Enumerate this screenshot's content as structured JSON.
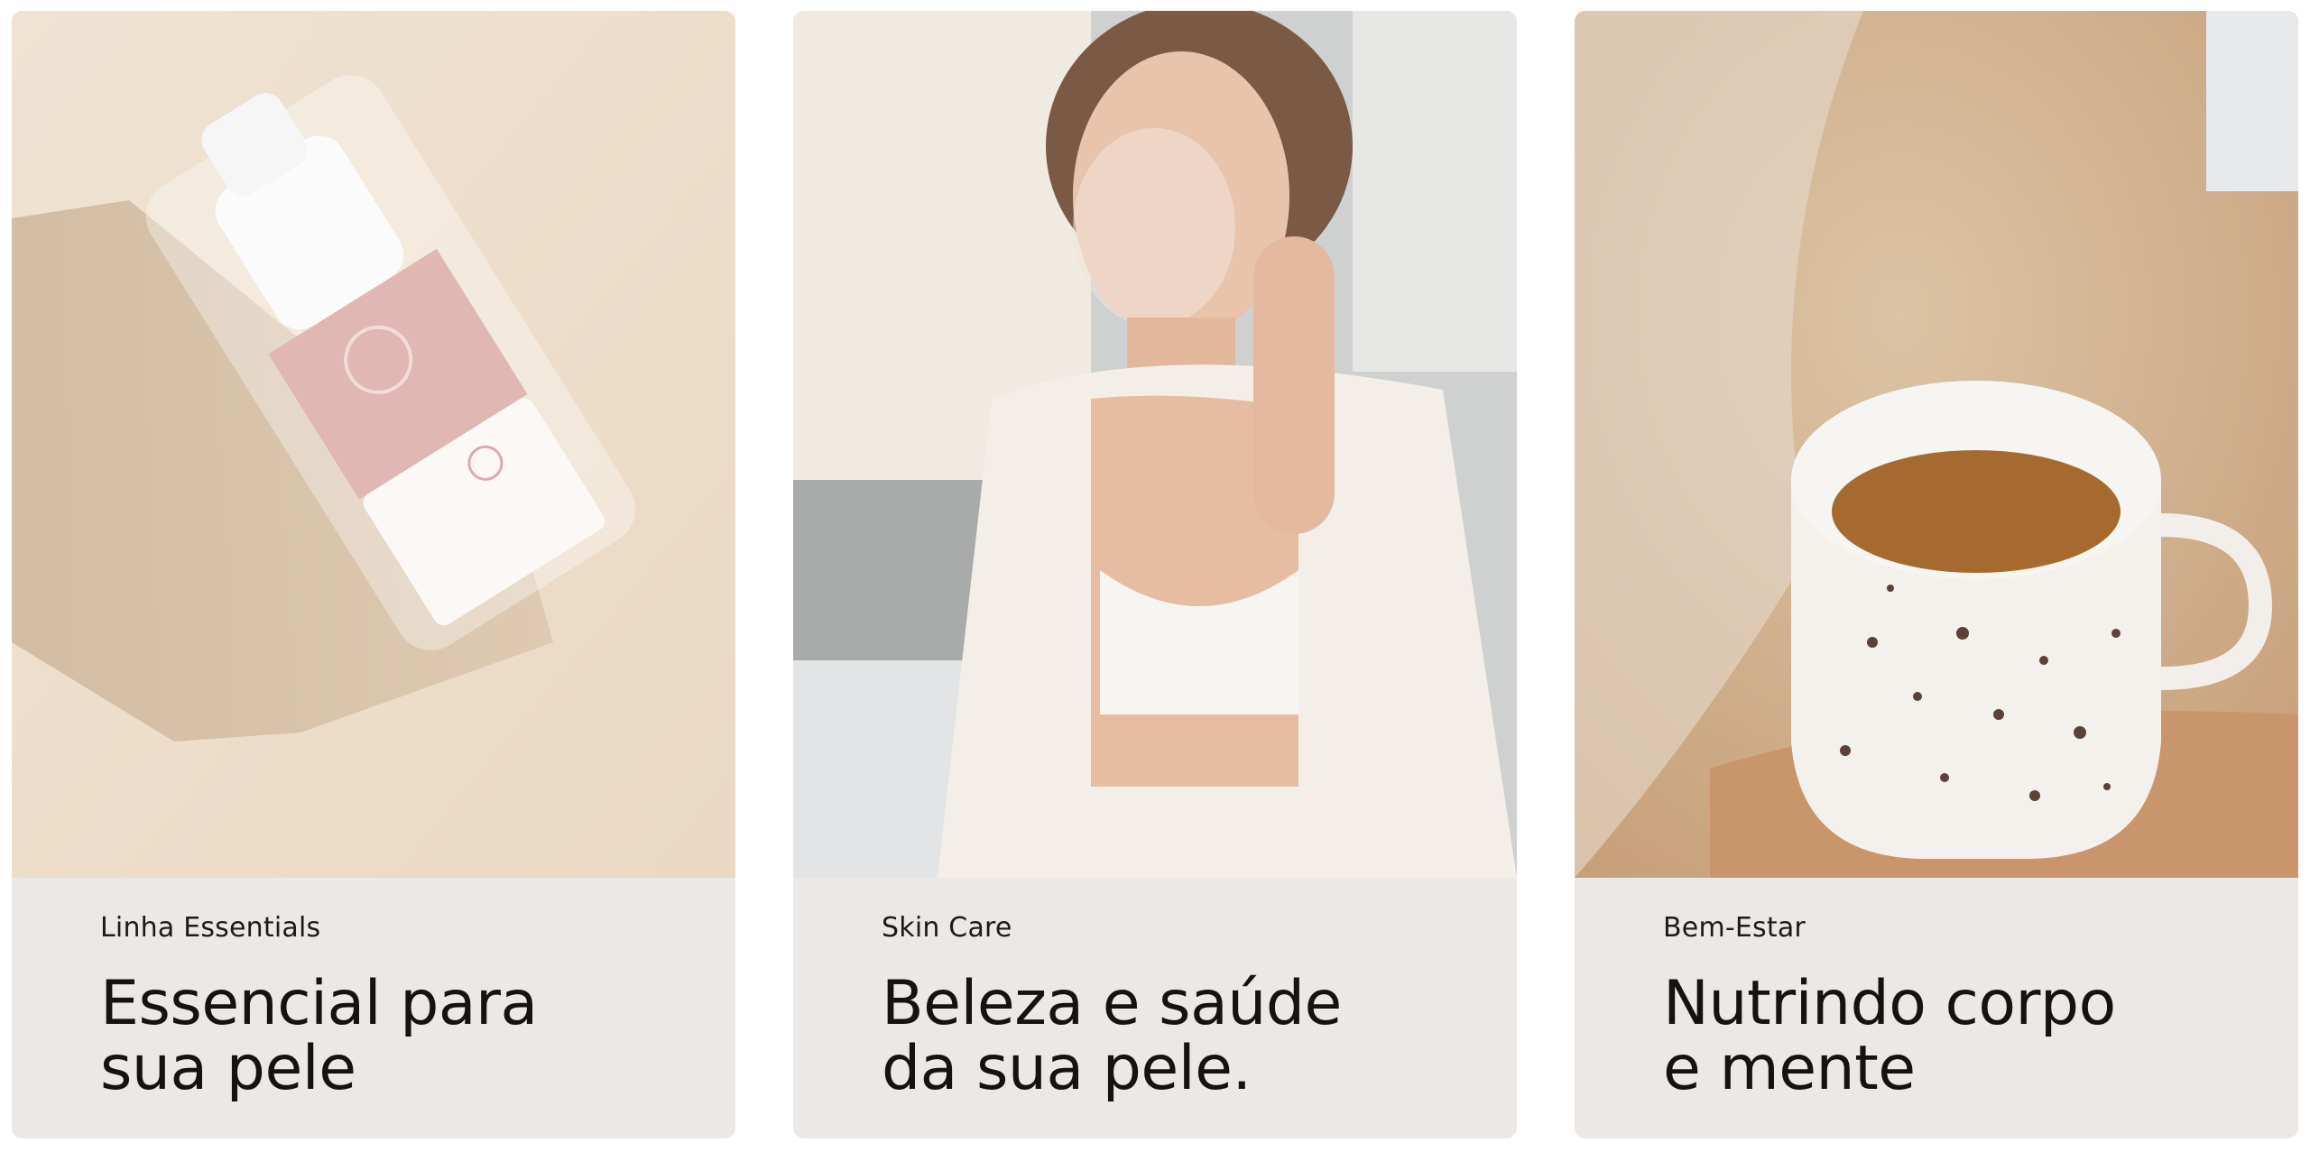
{
  "cards": [
    {
      "eyebrow": "Linha Essentials",
      "headline_line1": "Essencial para",
      "headline_line2": "sua pele",
      "image": "serum-bottle-product-photo"
    },
    {
      "eyebrow": "Skin Care",
      "headline_line1": "Beleza e saúde",
      "headline_line2": "da sua pele.",
      "image": "woman-cleansing-face-photo"
    },
    {
      "eyebrow": "Bem-Estar",
      "headline_line1": "Nutrindo corpo",
      "headline_line2": "e mente",
      "image": "tea-mug-on-knit-blanket-photo"
    }
  ],
  "colors": {
    "caption_bg": "#ebe8e5",
    "text": "#141312"
  }
}
